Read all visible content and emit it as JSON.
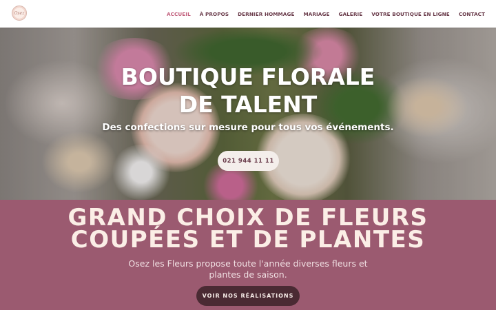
{
  "header": {
    "logo_text": "Osez",
    "nav": [
      "ACCUEIL",
      "À PROPOS",
      "DERNIER HOMMAGE",
      "MARIAGE",
      "GALERIE",
      "VOTRE BOUTIQUE EN LIGNE",
      "CONTACT"
    ],
    "active_index": 0
  },
  "hero": {
    "title": "BOUTIQUE FLORALE DE TALENT",
    "subtitle": "Des confections sur mesure pour tous vos événements.",
    "phone": "021 944 11 11"
  },
  "section": {
    "title_line1": "GRAND CHOIX DE FLEURS",
    "title_line2": "COUPÉES ET DE PLANTES",
    "text": "Osez les Fleurs propose toute l'année diverses fleurs et plantes de saison.",
    "cta": "VOIR NOS RÉALISATIONS"
  },
  "colors": {
    "accent": "#c2607d",
    "nav_text": "#6a3c4b",
    "section_bg": "#9b5a70",
    "cta_bg": "#4a2a33"
  }
}
